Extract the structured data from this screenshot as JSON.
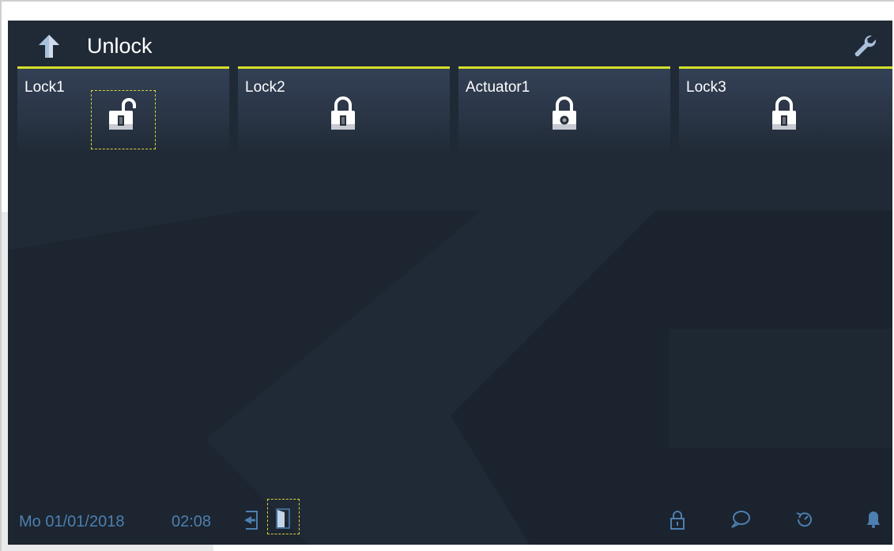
{
  "header": {
    "title": "Unlock",
    "back_icon": "arrow-up-icon",
    "settings_icon": "wrench-icon"
  },
  "tiles": [
    {
      "label": "Lock1",
      "icon": "padlock-open-door-icon",
      "state": "unlocked",
      "focused": true
    },
    {
      "label": "Lock2",
      "icon": "padlock-door-icon",
      "state": "locked",
      "focused": false
    },
    {
      "label": "Actuator1",
      "icon": "padlock-actuator-icon",
      "state": "locked",
      "focused": false
    },
    {
      "label": "Lock3",
      "icon": "padlock-door-icon",
      "state": "locked",
      "focused": false
    }
  ],
  "status_bar": {
    "date": "Mo 01/01/2018",
    "time": "02:08",
    "left_icons": [
      "door-exit-icon",
      "door-open-icon"
    ],
    "right_icons": [
      "padlock-icon",
      "message-bubble-icon",
      "history-clock-icon",
      "bell-icon"
    ]
  },
  "colors": {
    "screen_bg": "#202a36",
    "tile_accent": "#d4e02a",
    "status_text": "#4d7fb0",
    "focus_outline": "#d9d23a",
    "header_icon": "#a9c0db"
  }
}
